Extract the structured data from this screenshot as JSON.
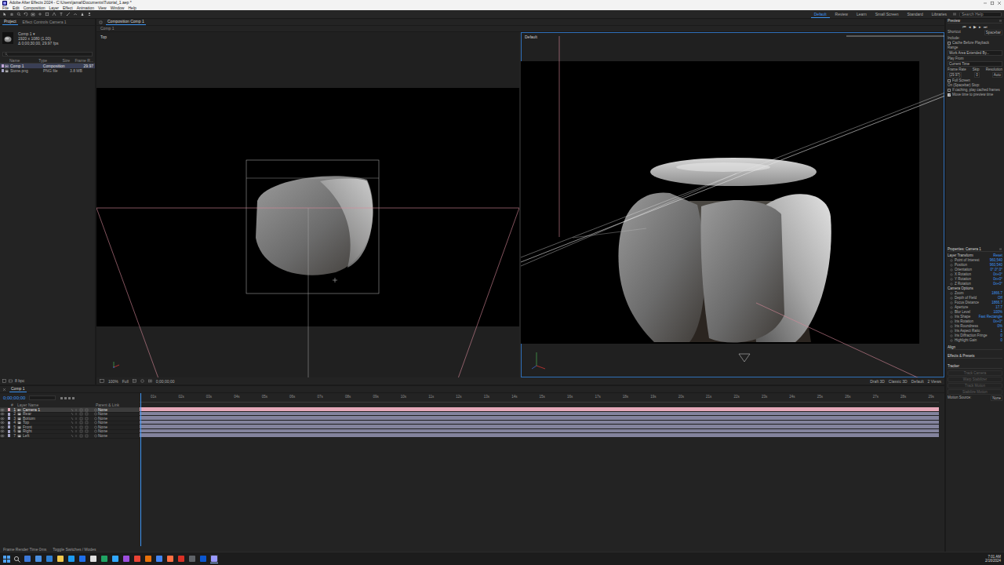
{
  "window": {
    "title": "Adobe After Effects 2024 - C:\\Users\\jamal\\Documents\\Tutorial_1.aep *"
  },
  "menu": [
    "File",
    "Edit",
    "Composition",
    "Layer",
    "Effect",
    "Animation",
    "View",
    "Window",
    "Help"
  ],
  "workspaces": [
    {
      "label": "Default",
      "selected": true
    },
    {
      "label": "Review",
      "selected": false
    },
    {
      "label": "Learn",
      "selected": false
    },
    {
      "label": "Small Screen",
      "selected": false
    },
    {
      "label": "Standard",
      "selected": false
    },
    {
      "label": "Libraries",
      "selected": false
    }
  ],
  "search": {
    "placeholder": "Search Help"
  },
  "project": {
    "tabs": [
      {
        "label": "Project",
        "selected": true
      },
      {
        "label": "Effect Controls Camera 1",
        "selected": false
      }
    ],
    "info": [
      "Comp 1 ▾",
      "1920 x 1080 (1.00)",
      "Δ 0;00;30;00, 29.97 fps"
    ],
    "columns": [
      "Name",
      "Type",
      "Size",
      "Frame R..."
    ],
    "items": [
      {
        "name": "Comp 1",
        "type": "Composition",
        "rate": "29.97",
        "selected": true,
        "kind": "comp",
        "color": "#c6a8d8"
      },
      {
        "name": "Stone.png",
        "type": "PNG file",
        "size": "3.8 MB",
        "selected": false,
        "kind": "footage",
        "color": "#a6a6c8"
      }
    ],
    "footer": "8 bpc"
  },
  "comp": {
    "tab": "Composition Comp 1",
    "crumb": "Comp 1",
    "views": [
      {
        "label": "Top",
        "selected": false
      },
      {
        "label": "Default",
        "selected": true
      }
    ],
    "zoom": "100%",
    "resolution": "Full",
    "time": "0;00;00;00",
    "draft": "Draft 3D",
    "renderer": "Classic 3D",
    "view": "Default",
    "layout": "2 Views"
  },
  "timeline": {
    "tab": "Comp 1",
    "timecode": "0;00;00;00",
    "columns": [
      "#",
      "Layer Name",
      "Parent & Link"
    ],
    "ruler": [
      "01s",
      "02s",
      "03s",
      "04s",
      "05s",
      "06s",
      "07s",
      "08s",
      "09s",
      "10s",
      "11s",
      "12s",
      "13s",
      "14s",
      "15s",
      "16s",
      "17s",
      "18s",
      "19s",
      "20s",
      "21s",
      "22s",
      "23s",
      "24s",
      "25s",
      "26s",
      "27s",
      "28s",
      "29s"
    ],
    "layers": [
      {
        "num": "1",
        "name": "Camera 1",
        "parent": "None",
        "selected": true,
        "color": "#e5a8b9",
        "kind": "camera"
      },
      {
        "num": "2",
        "name": "Rear",
        "parent": "None",
        "selected": false,
        "color": "#a4a4c6",
        "kind": "footage"
      },
      {
        "num": "3",
        "name": "Bottom",
        "parent": "None",
        "selected": false,
        "color": "#a4a4c6",
        "kind": "footage"
      },
      {
        "num": "4",
        "name": "Top",
        "parent": "None",
        "selected": false,
        "color": "#a4a4c6",
        "kind": "footage"
      },
      {
        "num": "5",
        "name": "Front",
        "parent": "None",
        "selected": false,
        "color": "#a4a4c6",
        "kind": "footage"
      },
      {
        "num": "6",
        "name": "Right",
        "parent": "None",
        "selected": false,
        "color": "#a4a4c6",
        "kind": "footage"
      },
      {
        "num": "7",
        "name": "Left",
        "parent": "None",
        "selected": false,
        "color": "#a4a4c6",
        "kind": "footage"
      }
    ],
    "footer": [
      "Frame Render Time 0ms",
      "Toggle Switches / Modes"
    ]
  },
  "preview": {
    "title": "Preview",
    "controls": [
      "⏮",
      "◂",
      "▶",
      "▸",
      "⏭"
    ],
    "shortcut_label": "Shortcut",
    "shortcut": "Spacebar",
    "include": "Include:",
    "cache": {
      "label": "Cache Before Playback",
      "checked": false
    },
    "range_label": "Range",
    "range": "Work Area Extended By...",
    "play_from_label": "Play From",
    "play_from": "Current Time",
    "cols": [
      "Frame Rate",
      "Skip",
      "Resolution"
    ],
    "vals": [
      "(29.97)",
      "0",
      "Auto"
    ],
    "full_screen": {
      "label": "Full Screen",
      "checked": false
    },
    "stop_label": "On (Spacebar) Stop:",
    "options": [
      {
        "label": "If caching, play cached frames",
        "checked": false
      },
      {
        "label": "Move time to preview time",
        "checked": true
      }
    ]
  },
  "properties": {
    "title": "Properties: Camera 1",
    "transform": "Layer Transform",
    "reset": "Reset",
    "rows": [
      {
        "label": "Point of Interest",
        "value": "960,540"
      },
      {
        "label": "Position",
        "value": "960,540"
      },
      {
        "label": "Orientation",
        "value": "0°,0°,0°"
      },
      {
        "label": "X Rotation",
        "value": "0x+0°"
      },
      {
        "label": "Y Rotation",
        "value": "0x+0°"
      },
      {
        "label": "Z Rotation",
        "value": "0x+0°"
      }
    ],
    "options_title": "Camera Options",
    "options": [
      {
        "label": "Zoom",
        "value": "1866.7"
      },
      {
        "label": "Depth of Field",
        "value": "Off"
      },
      {
        "label": "Focus Distance",
        "value": "1866.7"
      },
      {
        "label": "Aperture",
        "value": "17.7"
      },
      {
        "label": "Blur Level",
        "value": "100%"
      },
      {
        "label": "Iris Shape",
        "value": "Fast Rectangle"
      },
      {
        "label": "Iris Rotation",
        "value": "0x+0°"
      },
      {
        "label": "Iris Roundness",
        "value": "0%"
      },
      {
        "label": "Iris Aspect Ratio",
        "value": "1"
      },
      {
        "label": "Iris Diffraction Fringe",
        "value": "0"
      },
      {
        "label": "Highlight Gain",
        "value": "0"
      }
    ],
    "more": [
      "Align",
      "Effects & Presets"
    ]
  },
  "tracker": {
    "title": "Tracker",
    "buttons": [
      {
        "label": "Track Camera",
        "disabled": true
      },
      {
        "label": "Warp Stabilizer",
        "disabled": true
      },
      {
        "label": "Track Motion",
        "disabled": true
      },
      {
        "label": "Stabilize Motion",
        "disabled": true
      }
    ],
    "source_label": "Motion Source:",
    "source": "None"
  },
  "taskbar": {
    "time": "7:01 AM",
    "date": "2/16/2024",
    "apps": [
      {
        "color": "#3b78d8",
        "selected": false
      },
      {
        "color": "#4a8fe0",
        "selected": false
      },
      {
        "color": "#2f7fd1",
        "selected": false
      },
      {
        "color": "#f2c94c",
        "selected": false
      },
      {
        "color": "#1d9bf0",
        "selected": false
      },
      {
        "color": "#1f6feb",
        "selected": false
      },
      {
        "color": "#e0e0e0",
        "selected": false
      },
      {
        "color": "#20a464",
        "selected": false
      },
      {
        "color": "#31a8ff",
        "selected": false
      },
      {
        "color": "#9d4edd",
        "selected": false
      },
      {
        "color": "#ea4335",
        "selected": false
      },
      {
        "color": "#e8710a",
        "selected": false
      },
      {
        "color": "#4285f4",
        "selected": false
      },
      {
        "color": "#ff7043",
        "selected": false
      },
      {
        "color": "#d93025",
        "selected": false
      },
      {
        "color": "#5f6368",
        "selected": false
      },
      {
        "color": "#0b57d0",
        "selected": false
      },
      {
        "color": "#9999ff",
        "selected": true
      }
    ]
  }
}
